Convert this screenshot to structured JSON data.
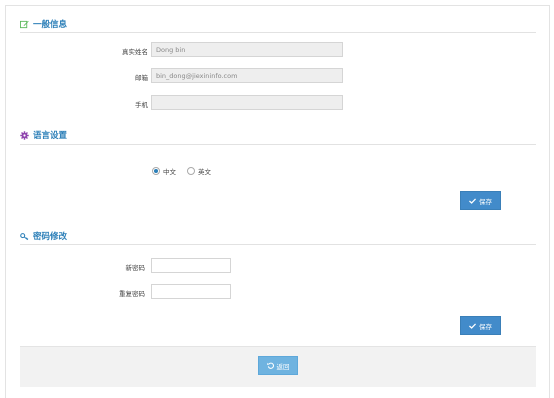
{
  "general": {
    "title": "一般信息",
    "realname_label": "真实姓名",
    "realname_value": "Dong bin",
    "email_label": "邮箱",
    "email_value": "bin_dong@jiexininfo.com",
    "mobile_label": "手机",
    "mobile_value": ""
  },
  "language": {
    "title": "语言设置",
    "options": [
      "中文",
      "英文"
    ],
    "selected": "中文",
    "save_label": "保存"
  },
  "password": {
    "title": "密码修改",
    "new_label": "新密码",
    "repeat_label": "重复密码",
    "save_label": "保存"
  },
  "footer": {
    "back_label": "返回"
  },
  "colors": {
    "accent": "#2c7fb8",
    "button": "#428bca",
    "back_button": "#6fb3e0"
  },
  "icons": {
    "general": "edit-icon",
    "language": "gear-icon",
    "password": "key-icon",
    "save": "check-icon",
    "back": "undo-icon"
  }
}
